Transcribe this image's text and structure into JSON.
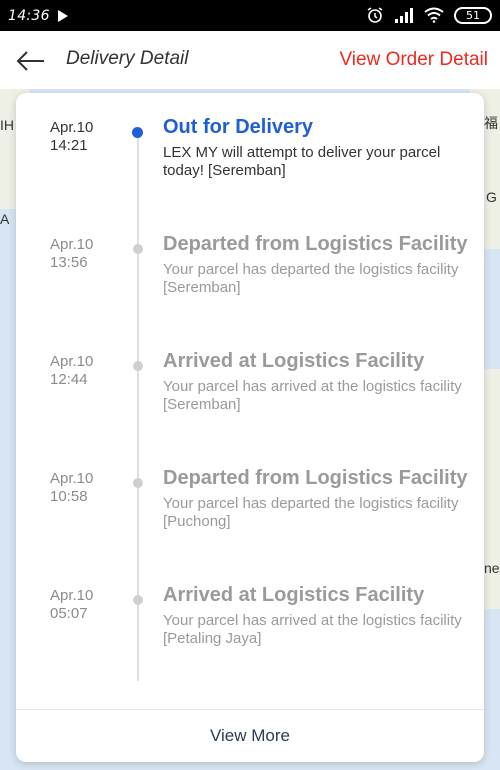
{
  "statusbar": {
    "time": "14:36",
    "battery": "51"
  },
  "header": {
    "title": "Delivery Detail",
    "view_order_label": "View Order Detail"
  },
  "map": {
    "labels": [
      "IH",
      "A",
      "福",
      "G",
      "ne"
    ]
  },
  "events": [
    {
      "date": "Apr.10",
      "time": "14:21",
      "status": "Out for Delivery",
      "desc": "LEX MY will attempt to deliver your parcel today!",
      "location": "Seremban"
    },
    {
      "date": "Apr.10",
      "time": "13:56",
      "status": "Departed from Logistics Facility",
      "desc": "Your parcel has departed the logistics facility",
      "location": "Seremban"
    },
    {
      "date": "Apr.10",
      "time": "12:44",
      "status": "Arrived at Logistics Facility",
      "desc": "Your parcel has arrived at the logistics facility",
      "location": "Seremban"
    },
    {
      "date": "Apr.10",
      "time": "10:58",
      "status": "Departed from Logistics Facility",
      "desc": "Your parcel has departed the logistics facility",
      "location": "Puchong"
    },
    {
      "date": "Apr.10",
      "time": "05:07",
      "status": "Arrived at Logistics Facility",
      "desc": "Your parcel has arrived at the logistics facility",
      "location": "Petaling Jaya"
    }
  ],
  "footer": {
    "view_more_label": "View More"
  },
  "colors": {
    "accent": "#1e5fd6",
    "brand_red": "#f0281e",
    "inactive": "#9a9a9a"
  }
}
